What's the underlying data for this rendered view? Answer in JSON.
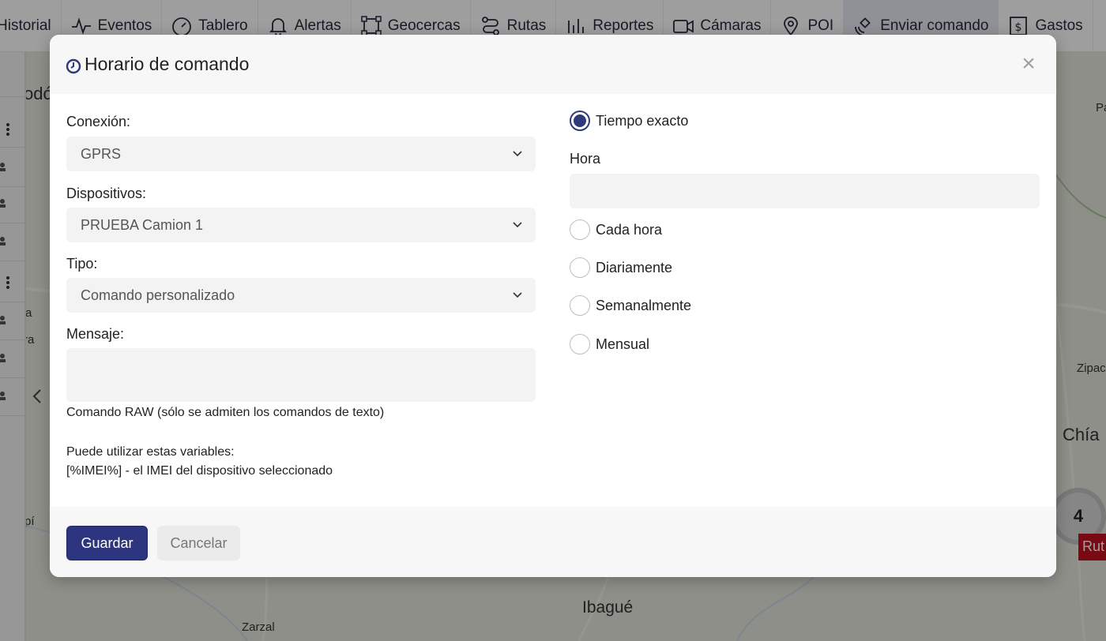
{
  "nav": {
    "items": [
      {
        "label": "Historial",
        "icon": "history-icon"
      },
      {
        "label": "Eventos",
        "icon": "pulse-icon"
      },
      {
        "label": "Tablero",
        "icon": "gauge-icon"
      },
      {
        "label": "Alertas",
        "icon": "bell-icon"
      },
      {
        "label": "Geocercas",
        "icon": "polygon-icon"
      },
      {
        "label": "Rutas",
        "icon": "route-icon"
      },
      {
        "label": "Reportes",
        "icon": "bar-chart-icon"
      },
      {
        "label": "Cámaras",
        "icon": "camera-icon"
      },
      {
        "label": "POI",
        "icon": "map-pin-icon"
      },
      {
        "label": "Enviar comando",
        "icon": "satellite-icon",
        "active": true
      },
      {
        "label": "Gastos",
        "icon": "dollar-icon"
      }
    ]
  },
  "map": {
    "labels": [
      "odó",
      "Pa",
      "Zipac",
      "Chía",
      "Ibagué",
      "Zarzal",
      "a",
      "ra",
      "pí"
    ],
    "cluster_count": "4",
    "route_tag": "Rut"
  },
  "modal": {
    "title": "Horario de comando",
    "close_symbol": "×",
    "fields": {
      "connection_label": "Conexión:",
      "connection_value": "GPRS",
      "devices_label": "Dispositivos:",
      "devices_value": "PRUEBA Camion 1",
      "type_label": "Tipo:",
      "type_value": "Comando personalizado",
      "message_label": "Mensaje:",
      "message_value": ""
    },
    "help": {
      "raw_note": "Comando RAW (sólo se admiten los comandos de texto)",
      "variables_title": "Puede utilizar estas variables:",
      "variables_line": "[%IMEI%] - el IMEI del dispositivo seleccionado"
    },
    "schedule": {
      "exact_time_label": "Tiempo exacto",
      "hour_label": "Hora",
      "hour_value": "",
      "hourly_label": "Cada hora",
      "daily_label": "Diariamente",
      "weekly_label": "Semanalmente",
      "monthly_label": "Mensual",
      "selected": "exact"
    },
    "footer": {
      "save_label": "Guardar",
      "cancel_label": "Cancelar"
    }
  },
  "colors": {
    "primary": "#2e3580",
    "radio_selected": "#2e3a7c",
    "route_tag": "#c3111f"
  }
}
